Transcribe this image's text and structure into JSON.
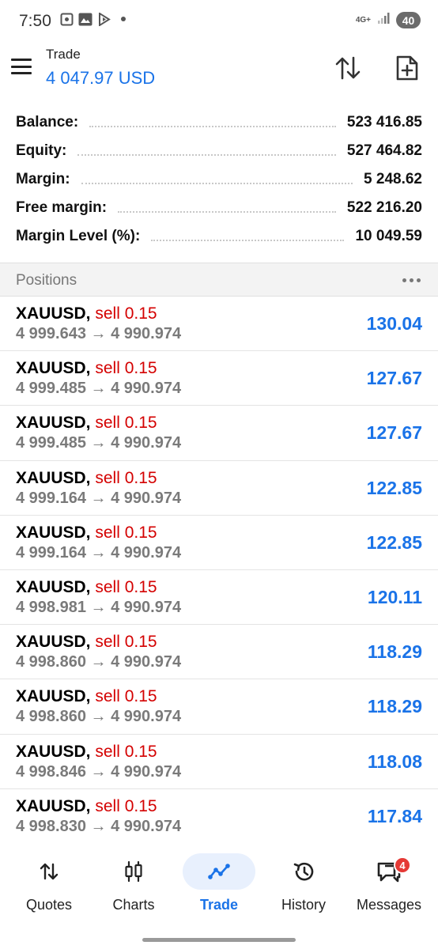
{
  "status_bar": {
    "time": "7:50",
    "network": "4G+",
    "battery": "40"
  },
  "header": {
    "title": "Trade",
    "subtitle": "4 047.97 USD"
  },
  "summary": [
    {
      "label": "Balance:",
      "value": "523 416.85"
    },
    {
      "label": "Equity:",
      "value": "527 464.82"
    },
    {
      "label": "Margin:",
      "value": "5 248.62"
    },
    {
      "label": "Free margin:",
      "value": "522 216.20"
    },
    {
      "label": "Margin Level (%):",
      "value": "10 049.59"
    }
  ],
  "positions": {
    "title": "Positions",
    "items": [
      {
        "symbol": "XAUUSD,",
        "side": "sell 0.15",
        "prices": "4 999.643 → 4 990.974",
        "profit": "130.04"
      },
      {
        "symbol": "XAUUSD,",
        "side": "sell 0.15",
        "prices": "4 999.485 → 4 990.974",
        "profit": "127.67"
      },
      {
        "symbol": "XAUUSD,",
        "side": "sell 0.15",
        "prices": "4 999.485 → 4 990.974",
        "profit": "127.67"
      },
      {
        "symbol": "XAUUSD,",
        "side": "sell 0.15",
        "prices": "4 999.164 → 4 990.974",
        "profit": "122.85"
      },
      {
        "symbol": "XAUUSD,",
        "side": "sell 0.15",
        "prices": "4 999.164 → 4 990.974",
        "profit": "122.85"
      },
      {
        "symbol": "XAUUSD,",
        "side": "sell 0.15",
        "prices": "4 998.981 → 4 990.974",
        "profit": "120.11"
      },
      {
        "symbol": "XAUUSD,",
        "side": "sell 0.15",
        "prices": "4 998.860 → 4 990.974",
        "profit": "118.29"
      },
      {
        "symbol": "XAUUSD,",
        "side": "sell 0.15",
        "prices": "4 998.860 → 4 990.974",
        "profit": "118.29"
      },
      {
        "symbol": "XAUUSD,",
        "side": "sell 0.15",
        "prices": "4 998.846 → 4 990.974",
        "profit": "118.08"
      },
      {
        "symbol": "XAUUSD,",
        "side": "sell 0.15",
        "prices": "4 998.830 → 4 990.974",
        "profit": "117.84"
      }
    ]
  },
  "bottom_nav": {
    "items": [
      {
        "label": "Quotes",
        "icon": "quotes-icon"
      },
      {
        "label": "Charts",
        "icon": "charts-icon"
      },
      {
        "label": "Trade",
        "icon": "trade-icon",
        "active": true
      },
      {
        "label": "History",
        "icon": "history-icon"
      },
      {
        "label": "Messages",
        "icon": "messages-icon",
        "badge": "4"
      }
    ]
  },
  "colors": {
    "accent": "#1a73e8",
    "sell": "#d40000",
    "badge": "#e53935"
  }
}
